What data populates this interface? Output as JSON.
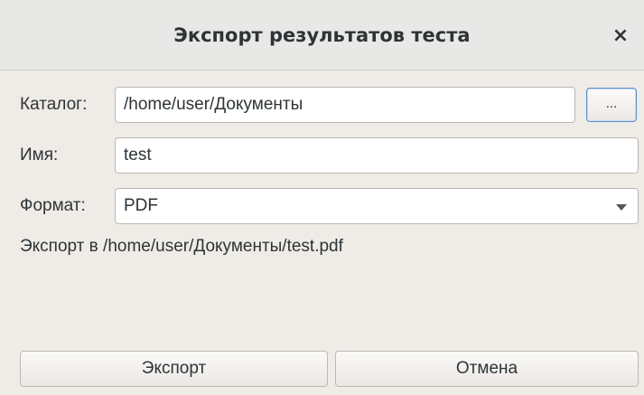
{
  "dialog": {
    "title": "Экспорт результатов теста",
    "close_label": "×"
  },
  "form": {
    "catalog": {
      "label": "Каталог:",
      "value": "/home/user/Документы",
      "browse_label": "..."
    },
    "name": {
      "label": "Имя:",
      "value": "test"
    },
    "format": {
      "label": "Формат:",
      "value": "PDF"
    }
  },
  "export_path": "Экспорт в /home/user/Документы/test.pdf",
  "buttons": {
    "export_label": "Экспорт",
    "cancel_label": "Отмена"
  },
  "colors": {
    "background": "#efebe7",
    "titlebar": "#e8e8e7",
    "focus_border": "#5c8fc8"
  },
  "icons": {
    "close": "close-icon",
    "dropdown": "chevron-down-icon"
  }
}
